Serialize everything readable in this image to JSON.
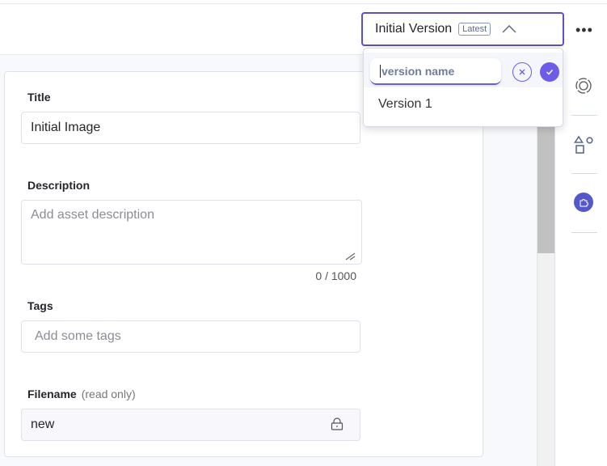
{
  "version_select": {
    "label": "Initial Version",
    "badge": "Latest"
  },
  "version_popup": {
    "input_placeholder": "version name",
    "items": [
      "Version 1"
    ]
  },
  "form": {
    "title": {
      "label": "Title",
      "value": "Initial Image"
    },
    "description": {
      "label": "Description",
      "placeholder": "Add asset description",
      "counter": "0 / 1000"
    },
    "tags": {
      "label": "Tags",
      "placeholder": "Add some tags"
    },
    "filename": {
      "label": "Filename",
      "note": "(read only)",
      "value": "new"
    }
  },
  "colors": {
    "accent": "#6c5ce7",
    "sidebar_active": "#5558c8"
  },
  "icons": [
    "more-icon",
    "chevron-up-icon",
    "close-icon",
    "check-icon",
    "target-icon",
    "shapes-icon",
    "puzzle-icon",
    "lock-icon",
    "resize-handle-icon"
  ]
}
